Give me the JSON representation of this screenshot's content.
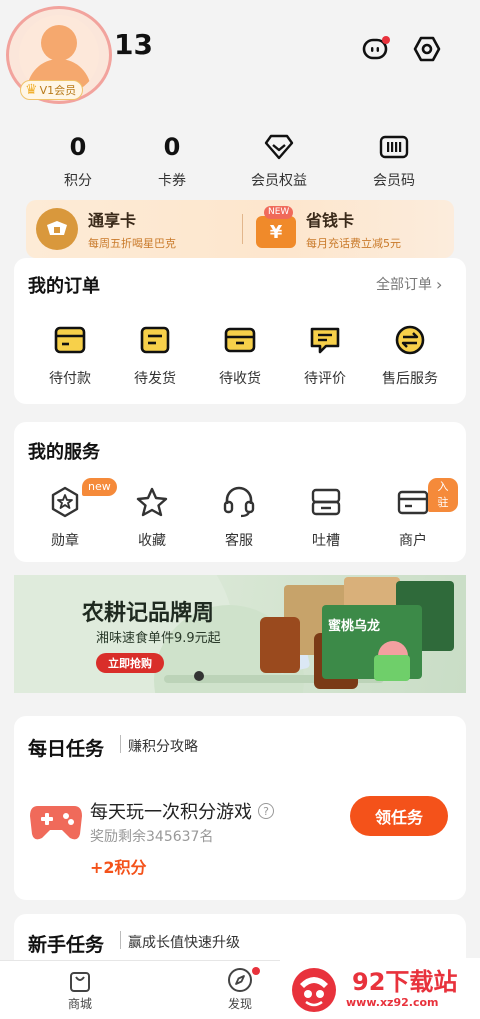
{
  "header": {
    "username": "13",
    "vip_label": "V1会员"
  },
  "stats": [
    {
      "value": "0",
      "label": "积分"
    },
    {
      "value": "0",
      "label": "卡券"
    },
    {
      "label": "会员权益"
    },
    {
      "label": "会员码"
    }
  ],
  "cards": {
    "tong_xiang": {
      "title": "通享卡",
      "subtitle": "每周五折喝星巴克"
    },
    "sheng_qian": {
      "title": "省钱卡",
      "subtitle": "每月充话费立减5元",
      "badge": "NEW",
      "icon_text": "¥"
    }
  },
  "orders": {
    "title": "我的订单",
    "all_label": "全部订单",
    "items": [
      {
        "label": "待付款",
        "icon": "wallet-icon"
      },
      {
        "label": "待发货",
        "icon": "package-list-icon"
      },
      {
        "label": "待收货",
        "icon": "box-icon"
      },
      {
        "label": "待评价",
        "icon": "comment-icon"
      },
      {
        "label": "售后服务",
        "icon": "exchange-icon"
      }
    ]
  },
  "services": {
    "title": "我的服务",
    "items": [
      {
        "label": "勋章",
        "icon": "medal-icon",
        "tag": "new"
      },
      {
        "label": "收藏",
        "icon": "star-icon"
      },
      {
        "label": "客服",
        "icon": "headset-icon"
      },
      {
        "label": "吐槽",
        "icon": "feedback-icon"
      },
      {
        "label": "商户",
        "icon": "merchant-card-icon",
        "tag": "入驻"
      }
    ]
  },
  "banner": {
    "title": "农耕记品牌周",
    "subtitle": "湘味速食单件9.9元起",
    "button": "立即抢购",
    "product_text": "蜜桃乌龙"
  },
  "daily": {
    "title": "每日任务",
    "link": "赚积分攻略",
    "task_name": "每天玩一次积分游戏",
    "task_remaining": "奖励剩余345637名",
    "task_reward": "+2积分",
    "task_button": "领任务"
  },
  "newbie": {
    "title": "新手任务",
    "link": "赢成长值快速升级"
  },
  "nav": {
    "items": [
      {
        "label": "商城"
      },
      {
        "label": "发现"
      }
    ]
  },
  "watermark": {
    "text": "92下载站",
    "url": "www.xz92.com"
  },
  "colors": {
    "accent": "#f4521a",
    "tag": "#f58a3a",
    "red_dot": "#e8323c"
  }
}
